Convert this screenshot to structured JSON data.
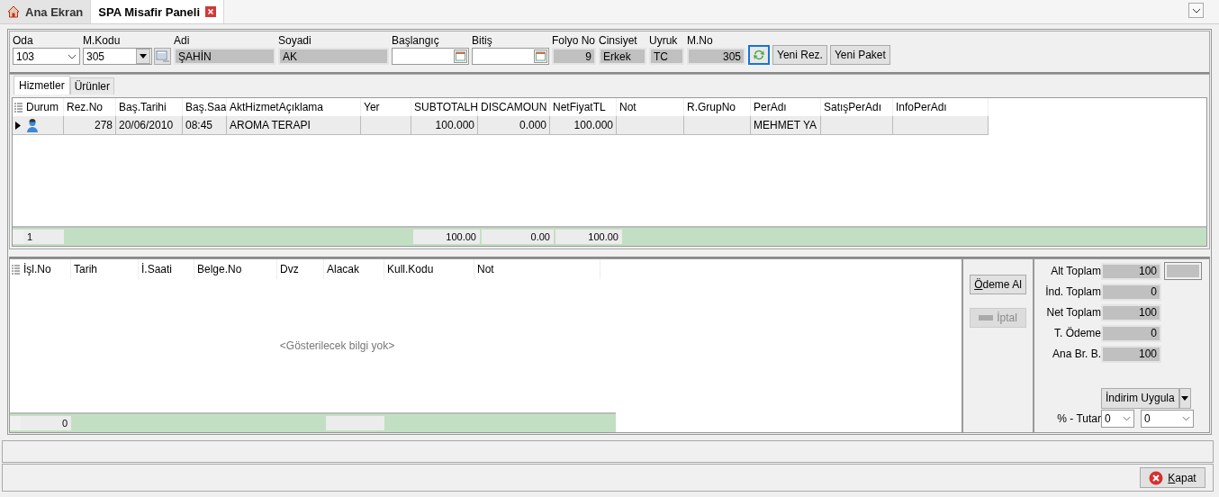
{
  "tabs": [
    {
      "label": "Ana Ekran",
      "selected": false,
      "closable": false,
      "home": true
    },
    {
      "label": "SPA Misafir Paneli",
      "selected": true,
      "closable": true,
      "home": false
    }
  ],
  "header": {
    "fields": [
      {
        "label": "Oda",
        "value": "103",
        "kind": "combo"
      },
      {
        "label": "M.Kodu",
        "value": "305",
        "kind": "lookup"
      },
      {
        "label": "Adi",
        "value": "ŞAHİN",
        "kind": "readonly"
      },
      {
        "label": "Soyadi",
        "value": "AK",
        "kind": "readonly"
      },
      {
        "label": "Başlangıç",
        "kind": "date"
      },
      {
        "label": "Bitiş",
        "kind": "date"
      },
      {
        "label": "Folyo No",
        "value": "9",
        "kind": "readonly",
        "numeric": true
      },
      {
        "label": "Cinsiyet",
        "value": "Erkek",
        "kind": "readonly"
      },
      {
        "label": "Uyruk",
        "value": "TC",
        "kind": "readonly"
      },
      {
        "label": "M.No",
        "value": "305",
        "kind": "readonly",
        "numeric": true
      }
    ],
    "buttons": [
      "Yeni Rez.",
      "Yeni Paket"
    ]
  },
  "services": {
    "tabs": [
      {
        "label": "Hizmetler",
        "selected": true
      },
      {
        "label": "Ürünler",
        "selected": false
      }
    ],
    "columns": [
      {
        "label": "Durum",
        "kind": "icon"
      },
      {
        "label": "Rez.No",
        "numeric": true
      },
      {
        "label": "Baş.Tarihi"
      },
      {
        "label": "Baş.Saa"
      },
      {
        "label": "AktHizmetAçıklama"
      },
      {
        "label": "Yer"
      },
      {
        "label": "SUBTOTALH",
        "numeric": true
      },
      {
        "label": "DISCAMOUN",
        "numeric": true
      },
      {
        "label": "NetFiyatTL",
        "numeric": true
      },
      {
        "label": "Not"
      },
      {
        "label": "R.GrupNo"
      },
      {
        "label": "PerAdı"
      },
      {
        "label": "SatışPerAdı"
      },
      {
        "label": "InfoPerAdı"
      }
    ],
    "rows": [
      {
        "selected": true,
        "cells": {
          "1": "278",
          "2": "20/06/2010",
          "3": "08:45",
          "4": "AROMA TERAPI",
          "6": "100.000",
          "7": "0.000",
          "8": "100.000",
          "11": "MEHMET YA"
        }
      }
    ],
    "footer": {
      "count": "1",
      "totals": {
        "6": "100.00",
        "7": "0.00",
        "8": "100.00"
      }
    }
  },
  "payments": {
    "columns": [
      "İşl.No",
      "Tarih",
      "İ.Saati",
      "Belge.No",
      "Dvz",
      "Alacak",
      "Kull.Kodu",
      "Not"
    ],
    "empty_message": "<Gösterilecek bilgi yok>",
    "footer": {
      "count": "0"
    }
  },
  "actions": [
    {
      "label": "Ödeme Al",
      "disabled": false
    },
    {
      "label": "İptal",
      "disabled": true
    }
  ],
  "totals": {
    "rows": [
      {
        "label": "Alt Toplam",
        "value": "100",
        "extra": true
      },
      {
        "label": "İnd. Toplam",
        "value": "0",
        "extra": false
      },
      {
        "label": "Net Toplam",
        "value": "100",
        "extra": false
      },
      {
        "label": "T. Ödeme",
        "value": "0",
        "extra": false
      },
      {
        "label": "Ana Br. B.",
        "value": "100",
        "extra": false
      }
    ],
    "discount_button": "İndirim Uygula",
    "percent_label": "% - Tutar",
    "percent": "0",
    "amount": "0"
  },
  "close_button": "Kapat"
}
